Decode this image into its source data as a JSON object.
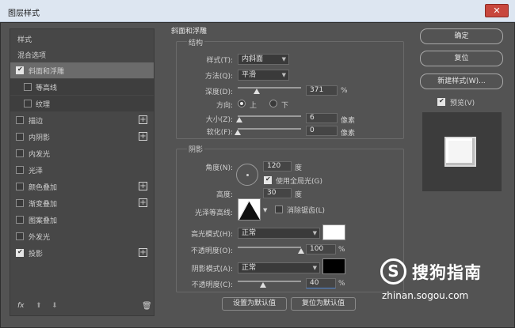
{
  "window": {
    "title": "图层样式",
    "close_label": "✕"
  },
  "left": {
    "items": [
      {
        "label": "样式",
        "checkbox": false,
        "plus": false
      },
      {
        "label": "混合选项",
        "checkbox": false,
        "plus": false
      },
      {
        "label": "斜面和浮雕",
        "checkbox": true,
        "checked": true,
        "plus": false,
        "selected": true
      },
      {
        "label": "等高线",
        "checkbox": true,
        "checked": false,
        "plus": false,
        "sub": true
      },
      {
        "label": "纹理",
        "checkbox": true,
        "checked": false,
        "plus": false,
        "sub": true
      },
      {
        "label": "描边",
        "checkbox": true,
        "checked": false,
        "plus": true
      },
      {
        "label": "内阴影",
        "checkbox": true,
        "checked": false,
        "plus": true
      },
      {
        "label": "内发光",
        "checkbox": true,
        "checked": false,
        "plus": false
      },
      {
        "label": "光泽",
        "checkbox": true,
        "checked": false,
        "plus": false
      },
      {
        "label": "颜色叠加",
        "checkbox": true,
        "checked": false,
        "plus": true
      },
      {
        "label": "渐变叠加",
        "checkbox": true,
        "checked": false,
        "plus": true
      },
      {
        "label": "图案叠加",
        "checkbox": true,
        "checked": false,
        "plus": false
      },
      {
        "label": "外发光",
        "checkbox": true,
        "checked": false,
        "plus": false
      },
      {
        "label": "投影",
        "checkbox": true,
        "checked": true,
        "plus": true
      }
    ],
    "footer": {
      "fx": "fx",
      "up": "⬆",
      "down": "⬇",
      "trash": "🗑"
    }
  },
  "bevel": {
    "section_title": "斜面和浮雕",
    "structure_title": "结构",
    "style_label": "样式(T):",
    "style_value": "内斜面",
    "technique_label": "方法(Q):",
    "technique_value": "平滑",
    "depth_label": "深度(D):",
    "depth_value": "371",
    "depth_unit": "%",
    "depth_pos": 0.3,
    "direction_label": "方向:",
    "dir_up": "上",
    "dir_down": "下",
    "size_label": "大小(Z):",
    "size_value": "6",
    "size_unit": "像素",
    "size_pos": 0.03,
    "soften_label": "软化(F):",
    "soften_value": "0",
    "soften_unit": "像素",
    "soften_pos": 0.0
  },
  "shading": {
    "title": "阴影",
    "angle_label": "角度(N):",
    "angle_value": "120",
    "angle_unit": "度",
    "global_light": "使用全局光(G)",
    "altitude_label": "高度:",
    "altitude_value": "30",
    "altitude_unit": "度",
    "gloss_label": "光泽等高线:",
    "antialias": "消除锯齿(L)",
    "highlight_label": "高光模式(H):",
    "highlight_value": "正常",
    "highlight_color": "#ffffff",
    "hl_opacity_label": "不透明度(O):",
    "hl_opacity_value": "100",
    "hl_opacity_unit": "%",
    "hl_opacity_pos": 1.0,
    "shadow_label": "阴影模式(A):",
    "shadow_value": "正常",
    "shadow_color": "#000000",
    "sh_opacity_label": "不透明度(C):",
    "sh_opacity_value": "40",
    "sh_opacity_unit": "%",
    "sh_opacity_pos": 0.4
  },
  "buttons": {
    "set_default": "设置为默认值",
    "reset_default": "复位为默认值",
    "ok": "确定",
    "reset": "复位",
    "new_style": "新建样式(W)...",
    "preview": "预览(V)"
  },
  "watermark": {
    "logo": "S",
    "cn": "搜狗指南",
    "url": "zhinan.sogou.com"
  }
}
